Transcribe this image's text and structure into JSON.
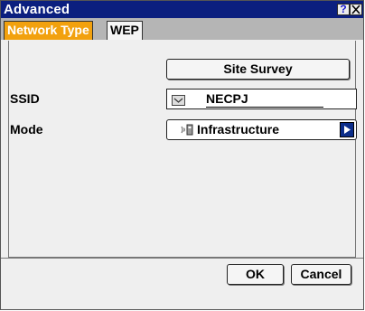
{
  "window": {
    "title": "Advanced",
    "help_button": "?",
    "close_button": "✕"
  },
  "tabs": [
    {
      "label": "Network Type",
      "active": true
    },
    {
      "label": "WEP",
      "active": false
    }
  ],
  "main": {
    "site_survey_label": "Site Survey",
    "ssid": {
      "label": "SSID",
      "value": "NECPJ"
    },
    "mode": {
      "label": "Mode",
      "value": "Infrastructure"
    }
  },
  "footer": {
    "ok_label": "OK",
    "cancel_label": "Cancel"
  },
  "colors": {
    "titlebar": "#0b1f7f",
    "active_tab": "#f2a10e",
    "mode_arrow": "#0b2d8a"
  }
}
